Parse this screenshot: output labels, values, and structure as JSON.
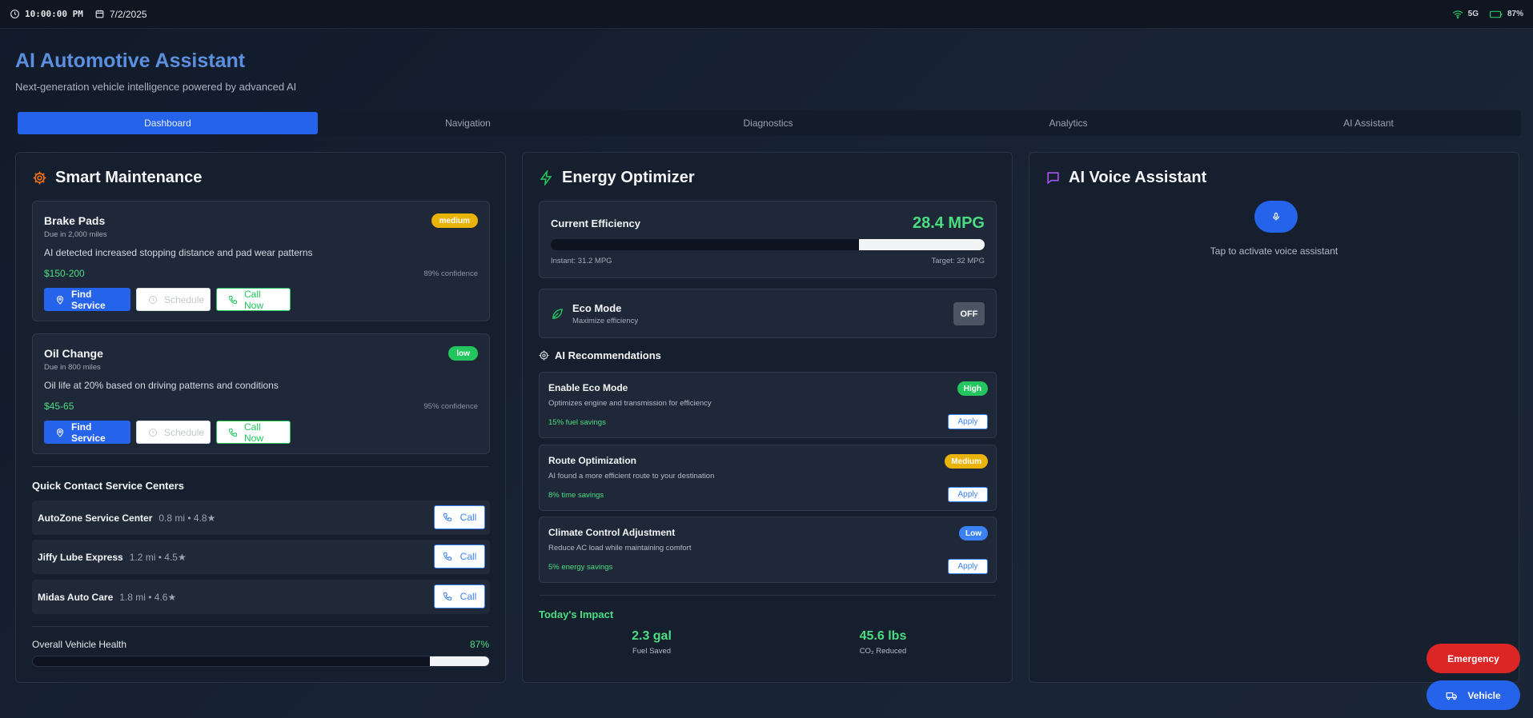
{
  "status_bar": {
    "time": "10:00:00 PM",
    "date": "7/2/2025",
    "network": "5G",
    "battery": "87%",
    "icons": [
      "clock-icon",
      "calendar-icon",
      "wifi-icon",
      "battery-icon"
    ]
  },
  "header": {
    "title": "AI Automotive Assistant",
    "subtitle": "Next-generation vehicle intelligence powered by advanced AI"
  },
  "tabs": [
    "Dashboard",
    "Navigation",
    "Diagnostics",
    "Analytics",
    "AI Assistant"
  ],
  "active_tab": "Dashboard",
  "maintenance": {
    "title": "Smart Maintenance",
    "items": [
      {
        "name": "Brake Pads",
        "due": "Due in 2,000 miles",
        "priority": "medium",
        "description": "AI detected increased stopping distance and pad wear patterns",
        "cost": "$150-200",
        "confidence": "89% confidence",
        "find_label": "Find Service",
        "schedule_label": "Schedule",
        "call_label": "Call Now"
      },
      {
        "name": "Oil Change",
        "due": "Due in 800 miles",
        "priority": "low",
        "description": "Oil life at 20% based on driving patterns and conditions",
        "cost": "$45-65",
        "confidence": "95% confidence",
        "find_label": "Find Service",
        "schedule_label": "Schedule",
        "call_label": "Call Now"
      }
    ],
    "quick_contact_title": "Quick Contact Service Centers",
    "centers": [
      {
        "name": "AutoZone Service Center",
        "meta": "0.8 mi • 4.8★",
        "call_label": "Call"
      },
      {
        "name": "Jiffy Lube Express",
        "meta": "1.2 mi • 4.5★",
        "call_label": "Call"
      },
      {
        "name": "Midas Auto Care",
        "meta": "1.8 mi • 4.6★",
        "call_label": "Call"
      }
    ],
    "health_label": "Overall Vehicle Health",
    "health_value": "87%",
    "health_fill_fraction": 0.13
  },
  "energy": {
    "title": "Energy Optimizer",
    "efficiency_label": "Current Efficiency",
    "efficiency_value": "28.4 MPG",
    "instant": "Instant: 31.2 MPG",
    "target": "Target: 32 MPG",
    "efficiency_fill_fraction": 0.29,
    "eco_title": "Eco Mode",
    "eco_subtitle": "Maximize efficiency",
    "eco_state": "OFF",
    "recommendations_title": "AI Recommendations",
    "recommendations": [
      {
        "title": "Enable Eco Mode",
        "description": "Optimizes engine and transmission for efficiency",
        "savings": "15% fuel savings",
        "priority": "High",
        "color": "#22c55e",
        "apply_label": "Apply"
      },
      {
        "title": "Route Optimization",
        "description": "AI found a more efficient route to your destination",
        "savings": "8% time savings",
        "priority": "Medium",
        "color": "#eab308",
        "apply_label": "Apply"
      },
      {
        "title": "Climate Control Adjustment",
        "description": "Reduce AC load while maintaining comfort",
        "savings": "5% energy savings",
        "priority": "Low",
        "color": "#3b82f6",
        "apply_label": "Apply"
      }
    ],
    "impact_title": "Today's Impact",
    "impact": [
      {
        "value": "2.3 gal",
        "label": "Fuel Saved"
      },
      {
        "value": "45.6 lbs",
        "label": "CO₂ Reduced"
      }
    ]
  },
  "voice": {
    "title": "AI Voice Assistant",
    "hint": "Tap to activate voice assistant"
  },
  "fabs": {
    "emergency": "Emergency",
    "vehicle": "Vehicle"
  },
  "colors": {
    "accent": "#2563eb",
    "title": "#5b8fe0",
    "success": "#4ade80",
    "warning": "#eab308",
    "danger": "#dc2626"
  }
}
